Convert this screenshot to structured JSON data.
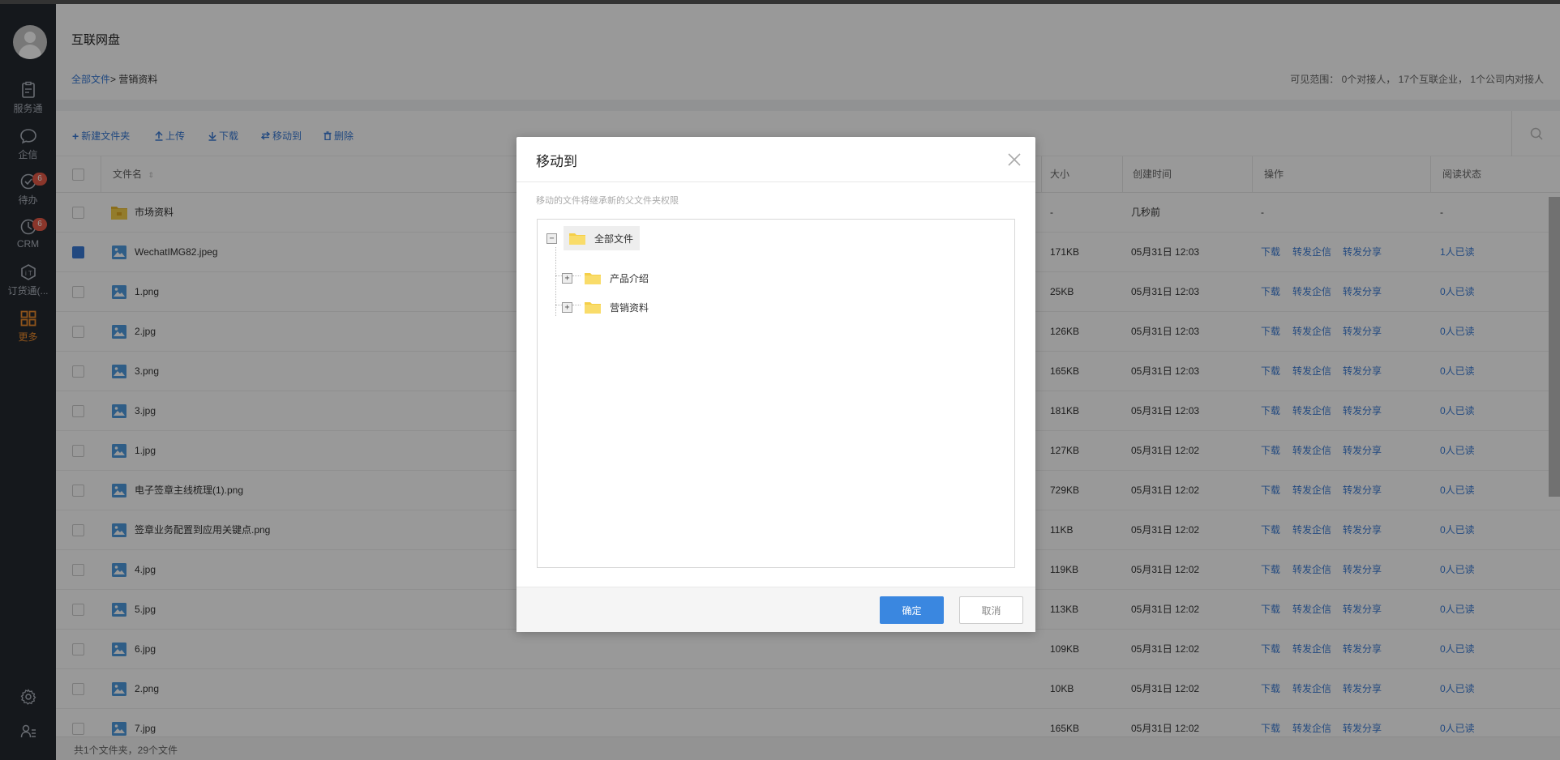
{
  "app": {
    "title": "互联网盘"
  },
  "breadcrumb": {
    "root": "全部文件",
    "separator": ">",
    "current": "营销资料"
  },
  "visibility": "可见范围： 0个对接人， 17个互联企业， 1个公司内对接人",
  "sidebar": {
    "items": [
      {
        "label": "服务通",
        "icon": "clipboard-icon",
        "badge": ""
      },
      {
        "label": "企信",
        "icon": "chat-bubble-icon",
        "badge": ""
      },
      {
        "label": "待办",
        "icon": "check-circle-icon",
        "badge": "6"
      },
      {
        "label": "CRM",
        "icon": "crm-icon",
        "badge": "6"
      },
      {
        "label": "订货通(...",
        "icon": "order-icon",
        "badge": ""
      },
      {
        "label": "更多",
        "icon": "grid-icon",
        "badge": ""
      }
    ]
  },
  "toolbar": {
    "new_folder": "新建文件夹",
    "upload": "上传",
    "download": "下载",
    "move": "移动到",
    "delete": "删除"
  },
  "table": {
    "headers": {
      "name": "文件名",
      "size": "大小",
      "created": "创建时间",
      "actions": "操作",
      "read_status": "阅读状态"
    },
    "action_labels": {
      "download": "下载",
      "forward_msg": "转发企信",
      "share": "转发分享"
    },
    "rows": [
      {
        "name": "市场资料",
        "type": "folder",
        "size": "-",
        "created": "几秒前",
        "actions": "-",
        "read": "-",
        "checked": false
      },
      {
        "name": "WechatIMG82.jpeg",
        "type": "image",
        "size": "171KB",
        "created": "05月31日 12:03",
        "read": "1人已读",
        "checked": true
      },
      {
        "name": "1.png",
        "type": "image",
        "size": "25KB",
        "created": "05月31日 12:03",
        "read": "0人已读",
        "checked": false
      },
      {
        "name": "2.jpg",
        "type": "image",
        "size": "126KB",
        "created": "05月31日 12:03",
        "read": "0人已读",
        "checked": false
      },
      {
        "name": "3.png",
        "type": "image",
        "size": "165KB",
        "created": "05月31日 12:03",
        "read": "0人已读",
        "checked": false
      },
      {
        "name": "3.jpg",
        "type": "image",
        "size": "181KB",
        "created": "05月31日 12:03",
        "read": "0人已读",
        "checked": false
      },
      {
        "name": "1.jpg",
        "type": "image",
        "size": "127KB",
        "created": "05月31日 12:02",
        "read": "0人已读",
        "checked": false
      },
      {
        "name": "电子签章主线梳理(1).png",
        "type": "image",
        "size": "729KB",
        "created": "05月31日 12:02",
        "read": "0人已读",
        "checked": false
      },
      {
        "name": "签章业务配置到应用关键点.png",
        "type": "image",
        "size": "11KB",
        "created": "05月31日 12:02",
        "read": "0人已读",
        "checked": false
      },
      {
        "name": "4.jpg",
        "type": "image",
        "size": "119KB",
        "created": "05月31日 12:02",
        "read": "0人已读",
        "checked": false
      },
      {
        "name": "5.jpg",
        "type": "image",
        "size": "113KB",
        "created": "05月31日 12:02",
        "read": "0人已读",
        "checked": false
      },
      {
        "name": "6.jpg",
        "type": "image",
        "size": "109KB",
        "created": "05月31日 12:02",
        "read": "0人已读",
        "checked": false
      },
      {
        "name": "2.png",
        "type": "image",
        "size": "10KB",
        "created": "05月31日 12:02",
        "read": "0人已读",
        "checked": false
      },
      {
        "name": "7.jpg",
        "type": "image",
        "size": "165KB",
        "created": "05月31日 12:02",
        "read": "0人已读",
        "checked": false
      }
    ]
  },
  "footer": {
    "summary": "共1个文件夹，29个文件"
  },
  "dialog": {
    "title": "移动到",
    "hint": "移动的文件将继承新的父文件夹权限",
    "tree": {
      "root": {
        "label": "全部文件",
        "toggle": "−"
      },
      "children": [
        {
          "label": "产品介绍",
          "toggle": "+"
        },
        {
          "label": "营销资料",
          "toggle": "+"
        }
      ]
    },
    "ok_label": "确定",
    "cancel_label": "取消"
  },
  "colors": {
    "accent": "#3a7bd5",
    "primary_button": "#3a87e0",
    "sidebar_bg": "#24282f",
    "badge": "#e65b48",
    "active_nav": "#f08e2d",
    "folder": "#f5cf48"
  }
}
